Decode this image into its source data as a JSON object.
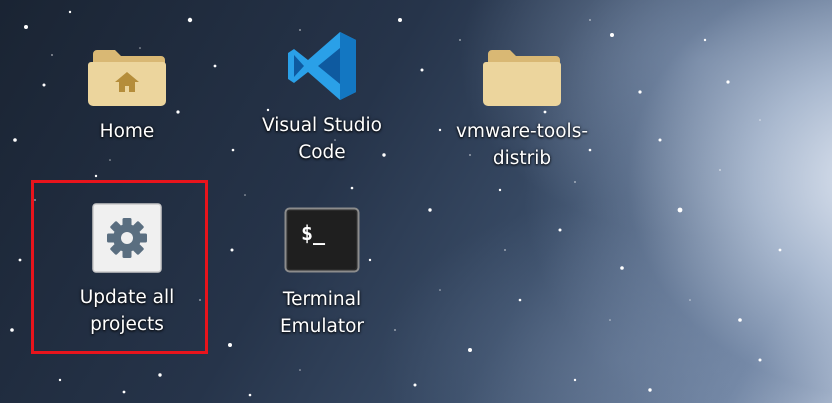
{
  "desktop": {
    "icons": [
      {
        "id": "home",
        "label": "Home",
        "icon": "folder-home-icon"
      },
      {
        "id": "vscode",
        "label": "Visual Studio Code",
        "icon": "vscode-icon"
      },
      {
        "id": "vmware",
        "label": "vmware-tools-distrib",
        "icon": "folder-icon"
      },
      {
        "id": "update",
        "label": "Update all projects",
        "icon": "gear-icon"
      },
      {
        "id": "terminal",
        "label": "Terminal Emulator",
        "icon": "terminal-icon"
      }
    ],
    "terminal_prompt": "$_"
  },
  "highlight": {
    "color": "#e8141c",
    "target": "update"
  },
  "colors": {
    "folder": "#e9cf93",
    "folder_dark": "#d9b874",
    "vscode_blue": "#1f8ad2",
    "terminal_bg": "#2b2b2b"
  }
}
